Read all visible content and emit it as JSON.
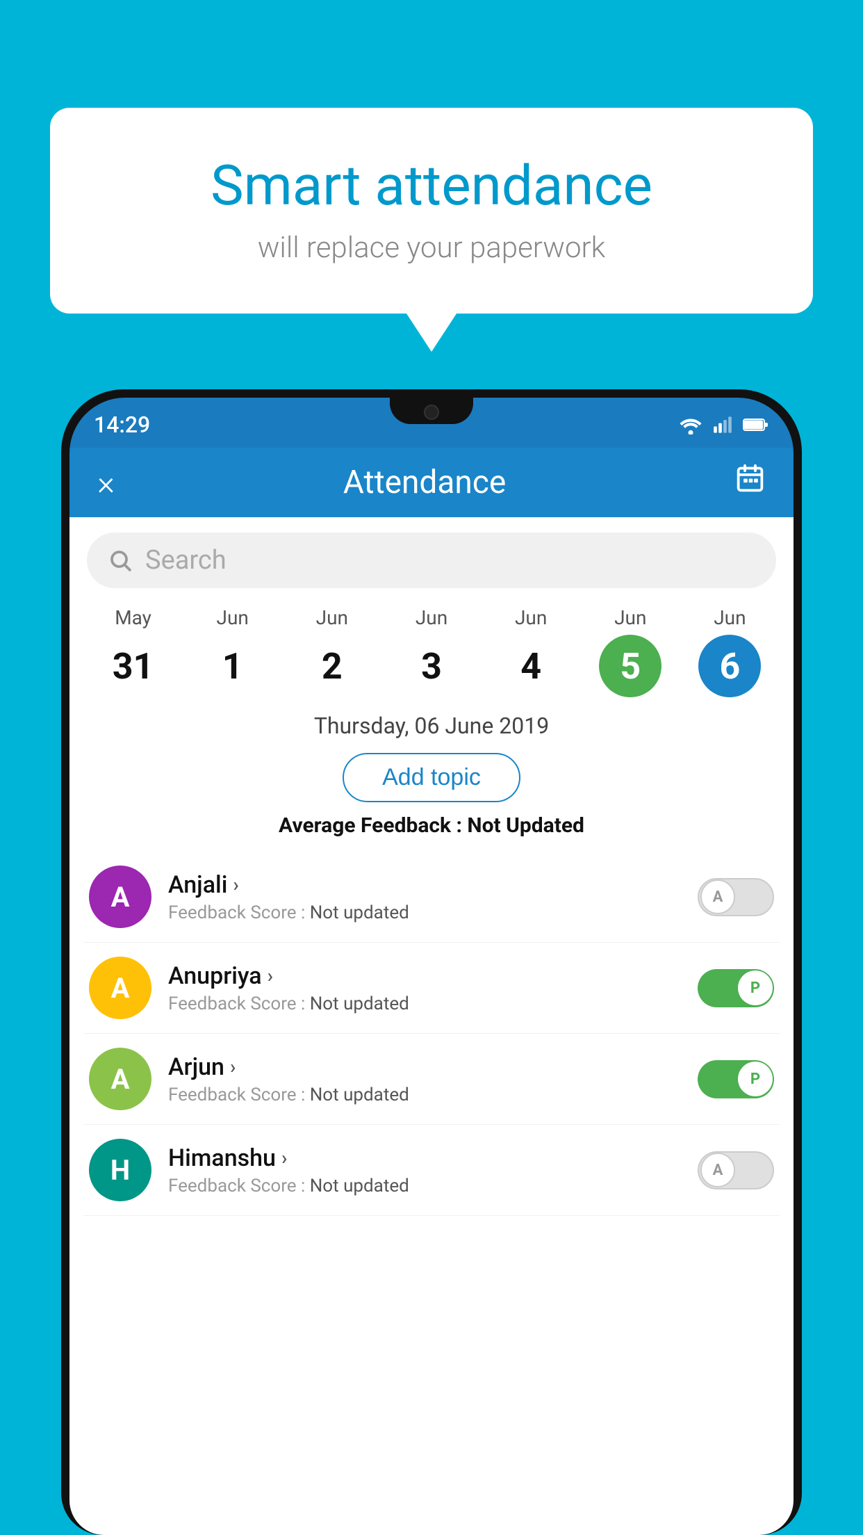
{
  "background_color": "#00b4d8",
  "bubble": {
    "title": "Smart attendance",
    "subtitle": "will replace your paperwork"
  },
  "status_bar": {
    "time": "14:29",
    "icons": [
      "wifi",
      "signal",
      "battery"
    ]
  },
  "app_bar": {
    "title": "Attendance",
    "close_label": "×",
    "calendar_label": "📅"
  },
  "search": {
    "placeholder": "Search"
  },
  "calendar": {
    "days": [
      {
        "month": "May",
        "date": "31",
        "style": "normal"
      },
      {
        "month": "Jun",
        "date": "1",
        "style": "normal"
      },
      {
        "month": "Jun",
        "date": "2",
        "style": "normal"
      },
      {
        "month": "Jun",
        "date": "3",
        "style": "normal"
      },
      {
        "month": "Jun",
        "date": "4",
        "style": "normal"
      },
      {
        "month": "Jun",
        "date": "5",
        "style": "green"
      },
      {
        "month": "Jun",
        "date": "6",
        "style": "blue"
      }
    ]
  },
  "selected_date": "Thursday, 06 June 2019",
  "add_topic_label": "Add topic",
  "avg_feedback_label": "Average Feedback :",
  "avg_feedback_value": "Not Updated",
  "students": [
    {
      "name": "Anjali",
      "initial": "A",
      "avatar_color": "purple",
      "feedback": "Not updated",
      "attendance": "absent"
    },
    {
      "name": "Anupriya",
      "initial": "A",
      "avatar_color": "yellow",
      "feedback": "Not updated",
      "attendance": "present"
    },
    {
      "name": "Arjun",
      "initial": "A",
      "avatar_color": "light-green",
      "feedback": "Not updated",
      "attendance": "present"
    },
    {
      "name": "Himanshu",
      "initial": "H",
      "avatar_color": "teal",
      "feedback": "Not updated",
      "attendance": "absent"
    }
  ]
}
